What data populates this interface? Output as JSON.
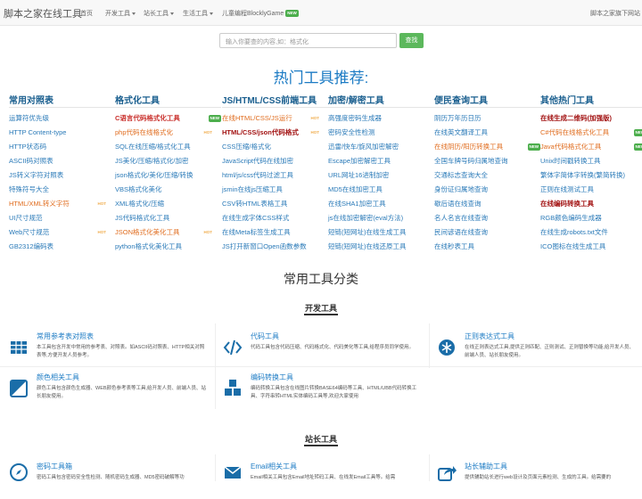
{
  "navbar": {
    "brand": "脚本之家在线工具",
    "items": [
      {
        "label": "首页",
        "dropdown": false
      },
      {
        "label": "开发工具",
        "dropdown": true
      },
      {
        "label": "站长工具",
        "dropdown": true
      },
      {
        "label": "生活工具",
        "dropdown": true
      },
      {
        "label": "儿童编程BlocklyGame",
        "dropdown": false,
        "badge": "NEW"
      }
    ],
    "right_link": "脚本之家旗下网站"
  },
  "search": {
    "placeholder": "输入你要查的内容,如：格式化",
    "button_label": "查找"
  },
  "hot_title": "热门工具推荐:",
  "columns": [
    {
      "title": "常用对照表",
      "items": [
        {
          "label": "运算符优先级",
          "style": "normal"
        },
        {
          "label": "HTTP Content-type",
          "style": "normal"
        },
        {
          "label": "HTTP状态码",
          "style": "normal"
        },
        {
          "label": "ASCII码对照表",
          "style": "normal"
        },
        {
          "label": "JS转义字符对照表",
          "style": "normal"
        },
        {
          "label": "特殊符号大全",
          "style": "normal"
        },
        {
          "label": "HTML/XML转义字符",
          "style": "orange",
          "badge": "HOT"
        },
        {
          "label": "UI尺寸规范",
          "style": "normal"
        },
        {
          "label": "Web尺寸规范",
          "style": "normal",
          "badge": "HOT"
        },
        {
          "label": "GB2312编码表",
          "style": "normal"
        }
      ]
    },
    {
      "title": "格式化工具",
      "items": [
        {
          "label": "C语言代码格式化工具",
          "style": "red",
          "badge": "NEW"
        },
        {
          "label": "php代码在线格式化",
          "style": "orange",
          "badge": "HOT"
        },
        {
          "label": "SQL在线压缩/格式化工具",
          "style": "normal"
        },
        {
          "label": "JS美化/压缩/格式化/加密",
          "style": "normal"
        },
        {
          "label": "json格式化/美化/压缩/转换",
          "style": "normal"
        },
        {
          "label": "VBS格式化美化",
          "style": "normal"
        },
        {
          "label": "XML格式化/压缩",
          "style": "normal"
        },
        {
          "label": "JS代码格式化工具",
          "style": "normal"
        },
        {
          "label": "JSON格式化美化工具",
          "style": "orange",
          "badge": "HOT"
        },
        {
          "label": "python格式化美化工具",
          "style": "normal"
        }
      ]
    },
    {
      "title": "JS/HTML/CSS前端工具",
      "items": [
        {
          "label": "在线HTML/CSS/JS运行",
          "style": "orange",
          "badge": "HOT"
        },
        {
          "label": "HTML/CSS/json代码格式",
          "style": "darkred",
          "badge": "HOT"
        },
        {
          "label": "CSS压缩/格式化",
          "style": "normal"
        },
        {
          "label": "JavaScript代码在线加密",
          "style": "normal"
        },
        {
          "label": "html/js/css代码过滤工具",
          "style": "normal"
        },
        {
          "label": "jsmin在线js压缩工具",
          "style": "normal"
        },
        {
          "label": "CSV转HTML表格工具",
          "style": "normal"
        },
        {
          "label": "在线生成字体CSS样式",
          "style": "normal"
        },
        {
          "label": "在线Meta标签生成工具",
          "style": "normal"
        },
        {
          "label": "JS打开新窗口Open函数参数",
          "style": "normal"
        }
      ]
    },
    {
      "title": "加密/解密工具",
      "items": [
        {
          "label": "高强度密码生成器",
          "style": "normal"
        },
        {
          "label": "密码安全性检测",
          "style": "normal"
        },
        {
          "label": "迅雷/快车/旋风加密解密",
          "style": "normal"
        },
        {
          "label": "Escape加密解密工具",
          "style": "normal"
        },
        {
          "label": "URL网址16进制加密",
          "style": "normal"
        },
        {
          "label": "MD5在线加密工具",
          "style": "normal"
        },
        {
          "label": "在线SHA1加密工具",
          "style": "normal"
        },
        {
          "label": "js在线加密解密(eval方法)",
          "style": "normal"
        },
        {
          "label": "短链(短网址)在线生成工具",
          "style": "normal"
        },
        {
          "label": "短链(短网址)在线还原工具",
          "style": "normal"
        }
      ]
    },
    {
      "title": "便民查询工具",
      "items": [
        {
          "label": "阴历万年历日历",
          "style": "normal"
        },
        {
          "label": "在线英文翻译工具",
          "style": "normal"
        },
        {
          "label": "在线阴历/阳历转换工具",
          "style": "orange",
          "badge": "NEW"
        },
        {
          "label": "全国车牌号码归属地查询",
          "style": "normal"
        },
        {
          "label": "交通标志查询大全",
          "style": "normal"
        },
        {
          "label": "身份证归属地查询",
          "style": "normal"
        },
        {
          "label": "歇后语在线查询",
          "style": "normal"
        },
        {
          "label": "名人名言在线查询",
          "style": "normal"
        },
        {
          "label": "民间谚语在线查询",
          "style": "normal"
        },
        {
          "label": "在线秒表工具",
          "style": "normal"
        }
      ]
    },
    {
      "title": "其他热门工具",
      "items": [
        {
          "label": "在线生成二维码(加强版)",
          "style": "darkred"
        },
        {
          "label": "C#代码在线格式化工具",
          "style": "orange",
          "badge": "NEW"
        },
        {
          "label": "Java代码格式化工具",
          "style": "orange",
          "badge": "NEW"
        },
        {
          "label": "Unix时间戳转换工具",
          "style": "normal"
        },
        {
          "label": "繁体字简体字转换(繁简转换)",
          "style": "normal"
        },
        {
          "label": "正则在线测试工具",
          "style": "normal"
        },
        {
          "label": "在线编码转换工具",
          "style": "darkred"
        },
        {
          "label": "RGB颜色编码生成器",
          "style": "normal"
        },
        {
          "label": "在线生成robots.txt文件",
          "style": "normal"
        },
        {
          "label": "ICO图标在线生成工具",
          "style": "normal"
        }
      ]
    }
  ],
  "categories_title": "常用工具分类",
  "dev_tools": {
    "title": "开发工具",
    "cards": [
      {
        "title": "常用参考表对照表",
        "desc": "本工具包含开发中常用的参考表、对照表。如ASCII码对照表、HTTP相关对照表等,方便开发人员参考。",
        "icon": "table-icon"
      },
      {
        "title": "代码工具",
        "desc": "代码工具包含代码压缩、代码格式化、代码美化等工具,给程序员同学使用。",
        "icon": "code-icon"
      },
      {
        "title": "正则表达式工具",
        "desc": "在线正则表达式工具,提供正则匹配、正则测试、正则替换等功能,给开发人员、前端人员、站长朋友使用。",
        "icon": "regex-icon"
      },
      {
        "title": "颜色相关工具",
        "desc": "颜色工具包含颜色生成器、WEB颜色参考表等工具,给开发人员、前端人员、站长朋友使用。",
        "icon": "palette-icon"
      },
      {
        "title": "编码转换工具",
        "desc": "编码转换工具包含在线图片转换BASE64编码等工具、HTML/UBB代码转换工具、字符串转HTML实体编码工具等,欢迎大家使用",
        "icon": "cubes-icon"
      }
    ]
  },
  "webmaster_tools": {
    "title": "站长工具",
    "cards": [
      {
        "title": "密码工具箱",
        "desc": "密码工具包含密码安全性检测、随机密码生成器、MD5密码破解等功",
        "icon": "compass-icon"
      },
      {
        "title": "Email相关工具",
        "desc": "Email相关工具包含Email地址转码工具、在线发Email工具等。给需",
        "icon": "envelope-icon"
      },
      {
        "title": "站长辅助工具",
        "desc": "提供辅助站长进行web设计及页面元素检测、生成的工具。给需要的",
        "icon": "share-icon"
      }
    ]
  }
}
